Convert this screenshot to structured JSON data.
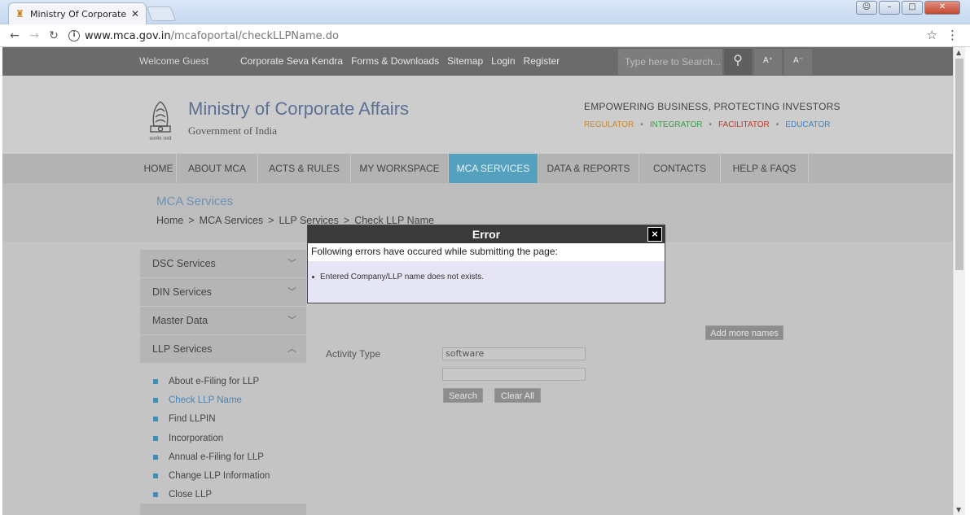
{
  "browser": {
    "tab_title": "Ministry Of Corporate Af",
    "url_host": "www.mca.gov.in",
    "url_path": "/mcafoportal/checkLLPName.do"
  },
  "topbar": {
    "welcome": "Welcome Guest",
    "links": [
      "Corporate Seva Kendra",
      "Forms & Downloads",
      "Sitemap",
      "Login",
      "Register"
    ],
    "search_placeholder": "Type here to Search...",
    "font_increase": "A⁺",
    "font_decrease": "A⁻"
  },
  "header": {
    "title": "Ministry of Corporate Affairs",
    "subtitle": "Government of India",
    "emblem_caption": "सत्यमेव जयते",
    "tagline": "EMPOWERING BUSINESS, PROTECTING INVESTORS",
    "roles": [
      {
        "label": "REGULATOR",
        "color": "#c9872a"
      },
      {
        "label": "INTEGRATOR",
        "color": "#3e9a4c"
      },
      {
        "label": "FACILITATOR",
        "color": "#c0392b"
      },
      {
        "label": "EDUCATOR",
        "color": "#3d85c6"
      }
    ]
  },
  "nav": {
    "items": [
      "HOME",
      "ABOUT MCA",
      "ACTS & RULES",
      "MY WORKSPACE",
      "MCA SERVICES",
      "DATA & REPORTS",
      "CONTACTS",
      "HELP & FAQS"
    ],
    "active": "MCA SERVICES"
  },
  "breadcrumb": {
    "title": "MCA Services",
    "path": [
      "Home",
      ">",
      "MCA Services",
      ">",
      "LLP Services",
      ">",
      "Check LLP Name"
    ]
  },
  "sidebar": {
    "sections": [
      "DSC Services",
      "DIN Services",
      "Master Data",
      "LLP Services"
    ],
    "llp_items": [
      "About e-Filing for LLP",
      "Check LLP Name",
      "Find LLPIN",
      "Incorporation",
      "Annual e-Filing for LLP",
      "Change LLP Information",
      "Close LLP"
    ],
    "active_item": "Check LLP Name"
  },
  "form": {
    "activity_label": "Activity Type",
    "activity_value": "software",
    "add_more_label": "Add more names",
    "search_label": "Search",
    "clear_label": "Clear All"
  },
  "dialog": {
    "title": "Error",
    "close": "×",
    "message": "Following errors have occured while submitting the page:",
    "errors": [
      "Entered Company/LLP name does not exists."
    ]
  }
}
